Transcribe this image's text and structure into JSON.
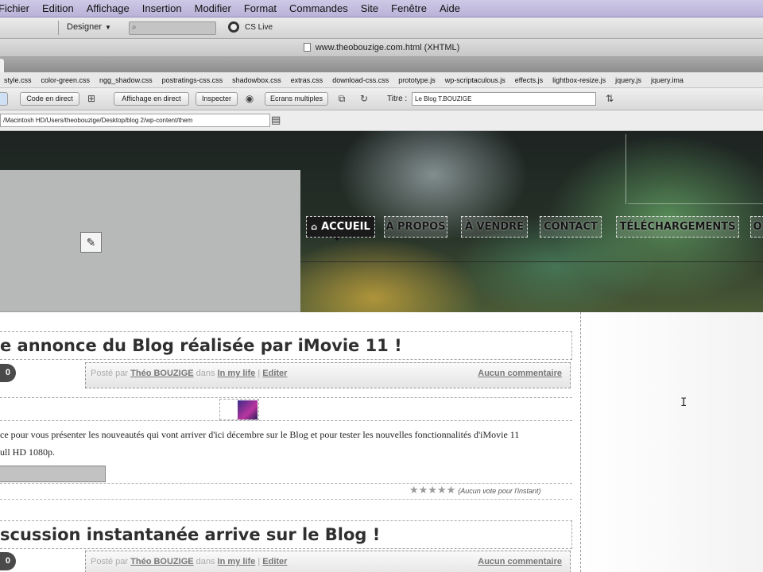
{
  "menu": [
    "Fichier",
    "Edition",
    "Affichage",
    "Insertion",
    "Modifier",
    "Format",
    "Commandes",
    "Site",
    "Fenêtre",
    "Aide"
  ],
  "toolbar": {
    "workspace": "Designer",
    "cslive": "CS Live"
  },
  "document": {
    "title": "www.theobouzige.com.html (XHTML)"
  },
  "related_files": [
    "style.css",
    "color-green.css",
    "ngg_shadow.css",
    "postratings-css.css",
    "shadowbox.css",
    "extras.css",
    "download-css.css",
    "prototype.js",
    "wp-scriptaculous.js",
    "effects.js",
    "lightbox-resize.js",
    "jquery.js",
    "jquery.ima"
  ],
  "doc_toolbar": {
    "code_live": "Code en direct",
    "live_view": "Affichage en direct",
    "inspect": "Inspecter",
    "multiscreen": "Ecrans multiples",
    "title_label": "Titre :",
    "title_value": "Le Blog T.BOUZIGE"
  },
  "address": "/Macintosh HD/Users/theobouzige/Desktop/blog 2/wp-content/them",
  "nav": [
    "ACCUEIL",
    "À PROPOS",
    "À VENDRE",
    "CONTACT",
    "TÉLÉCHARGEMENTS",
    "O"
  ],
  "posts": [
    {
      "title": "e annonce du Blog réalisée par iMovie 11 !",
      "badge": "0",
      "posted_by": "Posté par",
      "author": "Théo BOUZIGE",
      "in": "dans",
      "category": "In my life",
      "sep": "|",
      "edit": "Editer",
      "comments": "Aucun commentaire",
      "line1": "ce pour vous présenter les nouveautés qui vont arriver d'ici décembre sur le Blog et pour tester les nouvelles fonctionnalités d'iMovie 11",
      "line2": "ull HD 1080p.",
      "stars": "★★★★★",
      "votes": "(Aucun vote pour l'instant)"
    },
    {
      "title": "scussion instantanée arrive sur le Blog !",
      "badge": "0",
      "posted_by": "Posté par",
      "author": "Théo BOUZIGE",
      "in": "dans",
      "category": "In my life",
      "sep": "|",
      "edit": "Editer",
      "comments": "Aucun commentaire"
    }
  ]
}
